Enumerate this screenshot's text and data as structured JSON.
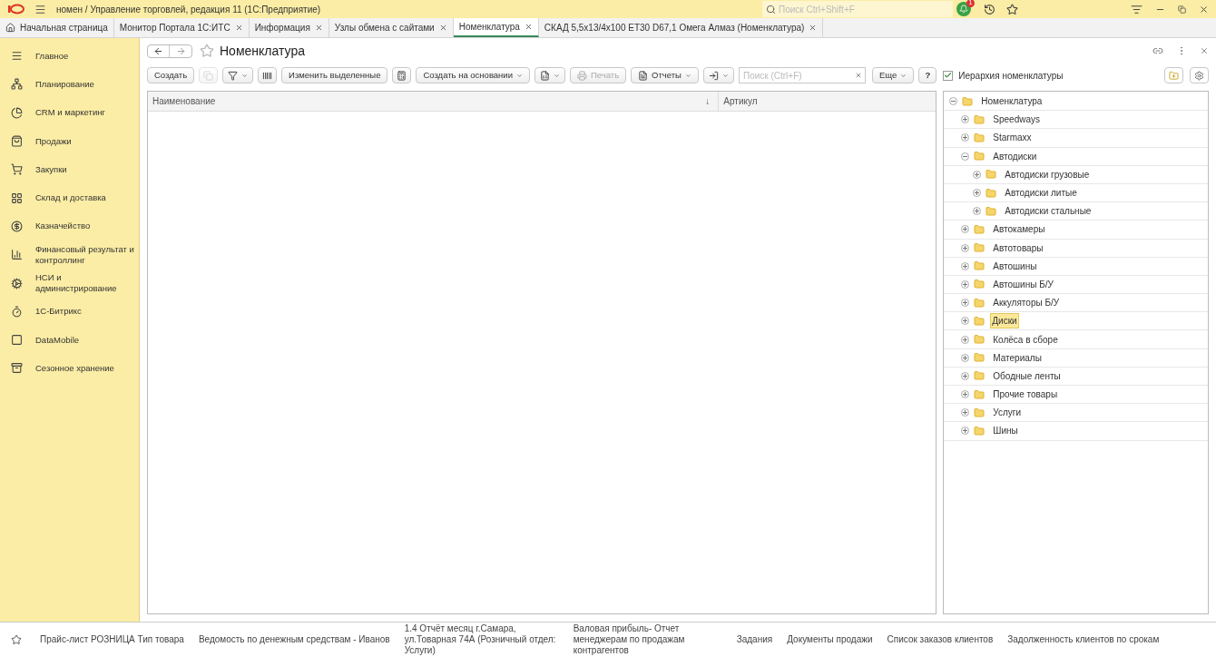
{
  "window": {
    "title": "номен / Управление торговлей, редакция 11  (1С:Предприятие)",
    "search": {
      "placeholder": "Поиск Ctrl+Shift+F"
    },
    "notifications": "1"
  },
  "tabs": [
    {
      "label": "Начальная страница",
      "kind": "home",
      "selected": false
    },
    {
      "label": "Монитор Портала 1С:ИТС",
      "kind": "tab",
      "selected": false
    },
    {
      "label": "Информация",
      "kind": "tab",
      "selected": false
    },
    {
      "label": "Узлы обмена с сайтами",
      "kind": "tab",
      "selected": false
    },
    {
      "label": "Номенклатура",
      "kind": "tab",
      "selected": true
    },
    {
      "label": "СКАД 5,5x13/4x100 ET30 D67,1 Омега Алмаз (Номенклатура)",
      "kind": "tab",
      "selected": false
    }
  ],
  "sidebar": {
    "items": [
      {
        "label": "Главное"
      },
      {
        "label": "Планирование"
      },
      {
        "label": "CRM и маркетинг"
      },
      {
        "label": "Продажи"
      },
      {
        "label": "Закупки"
      },
      {
        "label": "Склад и доставка"
      },
      {
        "label": "Казначейство"
      },
      {
        "label": "Финансовый результат и контроллинг"
      },
      {
        "label": "НСИ и администрирование"
      },
      {
        "label": "1С-Битрикс"
      },
      {
        "label": "DataMobile"
      },
      {
        "label": "Сезонное хранение"
      }
    ]
  },
  "form": {
    "title": "Номенклатура",
    "toolbar": [
      {
        "kind": "text",
        "label": "Создать"
      },
      {
        "kind": "icon",
        "disabled": true
      },
      {
        "kind": "icon-dropdown"
      },
      {
        "kind": "icon"
      },
      {
        "kind": "text",
        "label": "Изменить выделенные"
      },
      {
        "kind": "icon"
      },
      {
        "kind": "text-dropdown",
        "label": "Создать на основании"
      },
      {
        "kind": "icon-dropdown"
      },
      {
        "kind": "text",
        "label": "Печать",
        "disabled": true
      },
      {
        "kind": "text-dropdown",
        "label": "Отчеты"
      },
      {
        "kind": "icon-dropdown"
      }
    ],
    "search": {
      "placeholder": "Поиск (Ctrl+F)"
    },
    "more": "Еще",
    "help": "?",
    "hierarchy": {
      "label": "Иерархия номенклатуры",
      "checked": true
    },
    "table": {
      "columns": [
        "Наименование",
        "Артикул"
      ],
      "sort_mark": "↓"
    },
    "tree": [
      {
        "label": "Номенклатура",
        "expanded": true,
        "selected": false,
        "children": [
          {
            "label": "Speedways",
            "expanded": false,
            "selected": false
          },
          {
            "label": "Starmaxx",
            "expanded": false,
            "selected": false
          },
          {
            "label": "Автодиски",
            "expanded": true,
            "selected": false,
            "children": [
              {
                "label": "Автодиски грузовые",
                "expanded": false,
                "selected": false
              },
              {
                "label": "Автодиски литые",
                "expanded": false,
                "selected": false
              },
              {
                "label": "Автодиски стальные",
                "expanded": false,
                "selected": false
              }
            ]
          },
          {
            "label": "Автокамеры",
            "expanded": false,
            "selected": false
          },
          {
            "label": "Автотовары",
            "expanded": false,
            "selected": false
          },
          {
            "label": "Автошины",
            "expanded": false,
            "selected": false
          },
          {
            "label": "Автошины Б/У",
            "expanded": false,
            "selected": false
          },
          {
            "label": "Аккуляторы Б/У",
            "expanded": false,
            "selected": false
          },
          {
            "label": "Диски",
            "expanded": false,
            "selected": true
          },
          {
            "label": "Колёса в сборе",
            "expanded": false,
            "selected": false
          },
          {
            "label": "Материалы",
            "expanded": false,
            "selected": false
          },
          {
            "label": "Ободные ленты",
            "expanded": false,
            "selected": false
          },
          {
            "label": "Прочие товары",
            "expanded": false,
            "selected": false
          },
          {
            "label": "Услуги",
            "expanded": false,
            "selected": false
          },
          {
            "label": "Шины",
            "expanded": false,
            "selected": false
          }
        ]
      }
    ]
  },
  "status_bar": {
    "links": [
      "Прайс-лист РОЗНИЦА Тип товара",
      "Ведомость по денежным средствам - Иванов",
      "1.4 Отчёт месяц г.Самара, ул.Товарная 74А (Розничный отдел: Услуги)",
      "Валовая прибыль- Отчет менеджерам по продажам контрагентов",
      "Задания",
      "Документы продажи",
      "Список заказов клиентов",
      "Задолженность клиентов по срокам"
    ]
  }
}
